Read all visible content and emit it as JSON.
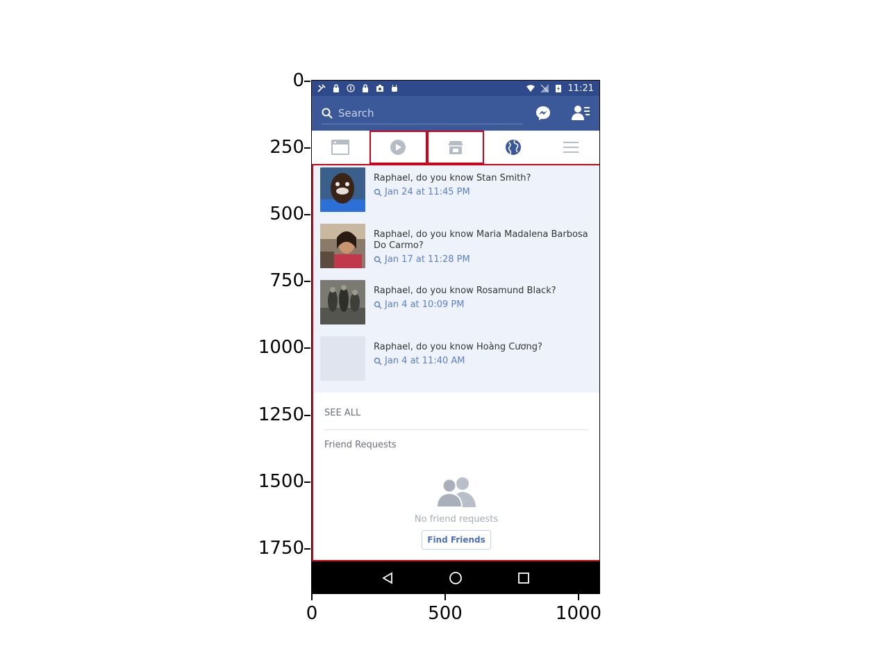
{
  "axes": {
    "y_ticks": [
      "0",
      "250",
      "500",
      "750",
      "1000",
      "1250",
      "1500",
      "1750"
    ],
    "x_ticks": [
      "0",
      "500",
      "1000"
    ]
  },
  "status_bar": {
    "time": "11:21",
    "left_icons": [
      "tools-icon",
      "lock-icon",
      "info-icon",
      "lock-icon",
      "camera-icon",
      "android-icon"
    ],
    "right_icons": [
      "wifi-icon",
      "no-signal-icon",
      "battery-charging-icon"
    ]
  },
  "search": {
    "placeholder": "Search"
  },
  "tabs": [
    {
      "name": "news-feed",
      "icon": "newsfeed-icon"
    },
    {
      "name": "video",
      "icon": "play-icon"
    },
    {
      "name": "marketplace",
      "icon": "store-icon"
    },
    {
      "name": "notifications",
      "icon": "globe-icon"
    },
    {
      "name": "menu",
      "icon": "menu-icon"
    }
  ],
  "notifications": [
    {
      "message": "Raphael, do you know Stan Smith?",
      "time": "Jan 24 at 11:45 PM"
    },
    {
      "message": "Raphael, do you know Maria Madalena Barbosa Do Carmo?",
      "time": "Jan 17 at 11:28 PM"
    },
    {
      "message": "Raphael, do you know Rosamund Black?",
      "time": "Jan 4 at 10:09 PM"
    },
    {
      "message": "Raphael, do you know Hoàng Cương?",
      "time": "Jan 4 at 11:40 AM"
    }
  ],
  "see_all": "SEE ALL",
  "friend_requests": {
    "title": "Friend Requests",
    "empty_text": "No friend requests",
    "button": "Find Friends"
  },
  "colors": {
    "brand": "#3b5998",
    "link": "#5b7fc4",
    "highlight": "#d0021b"
  }
}
